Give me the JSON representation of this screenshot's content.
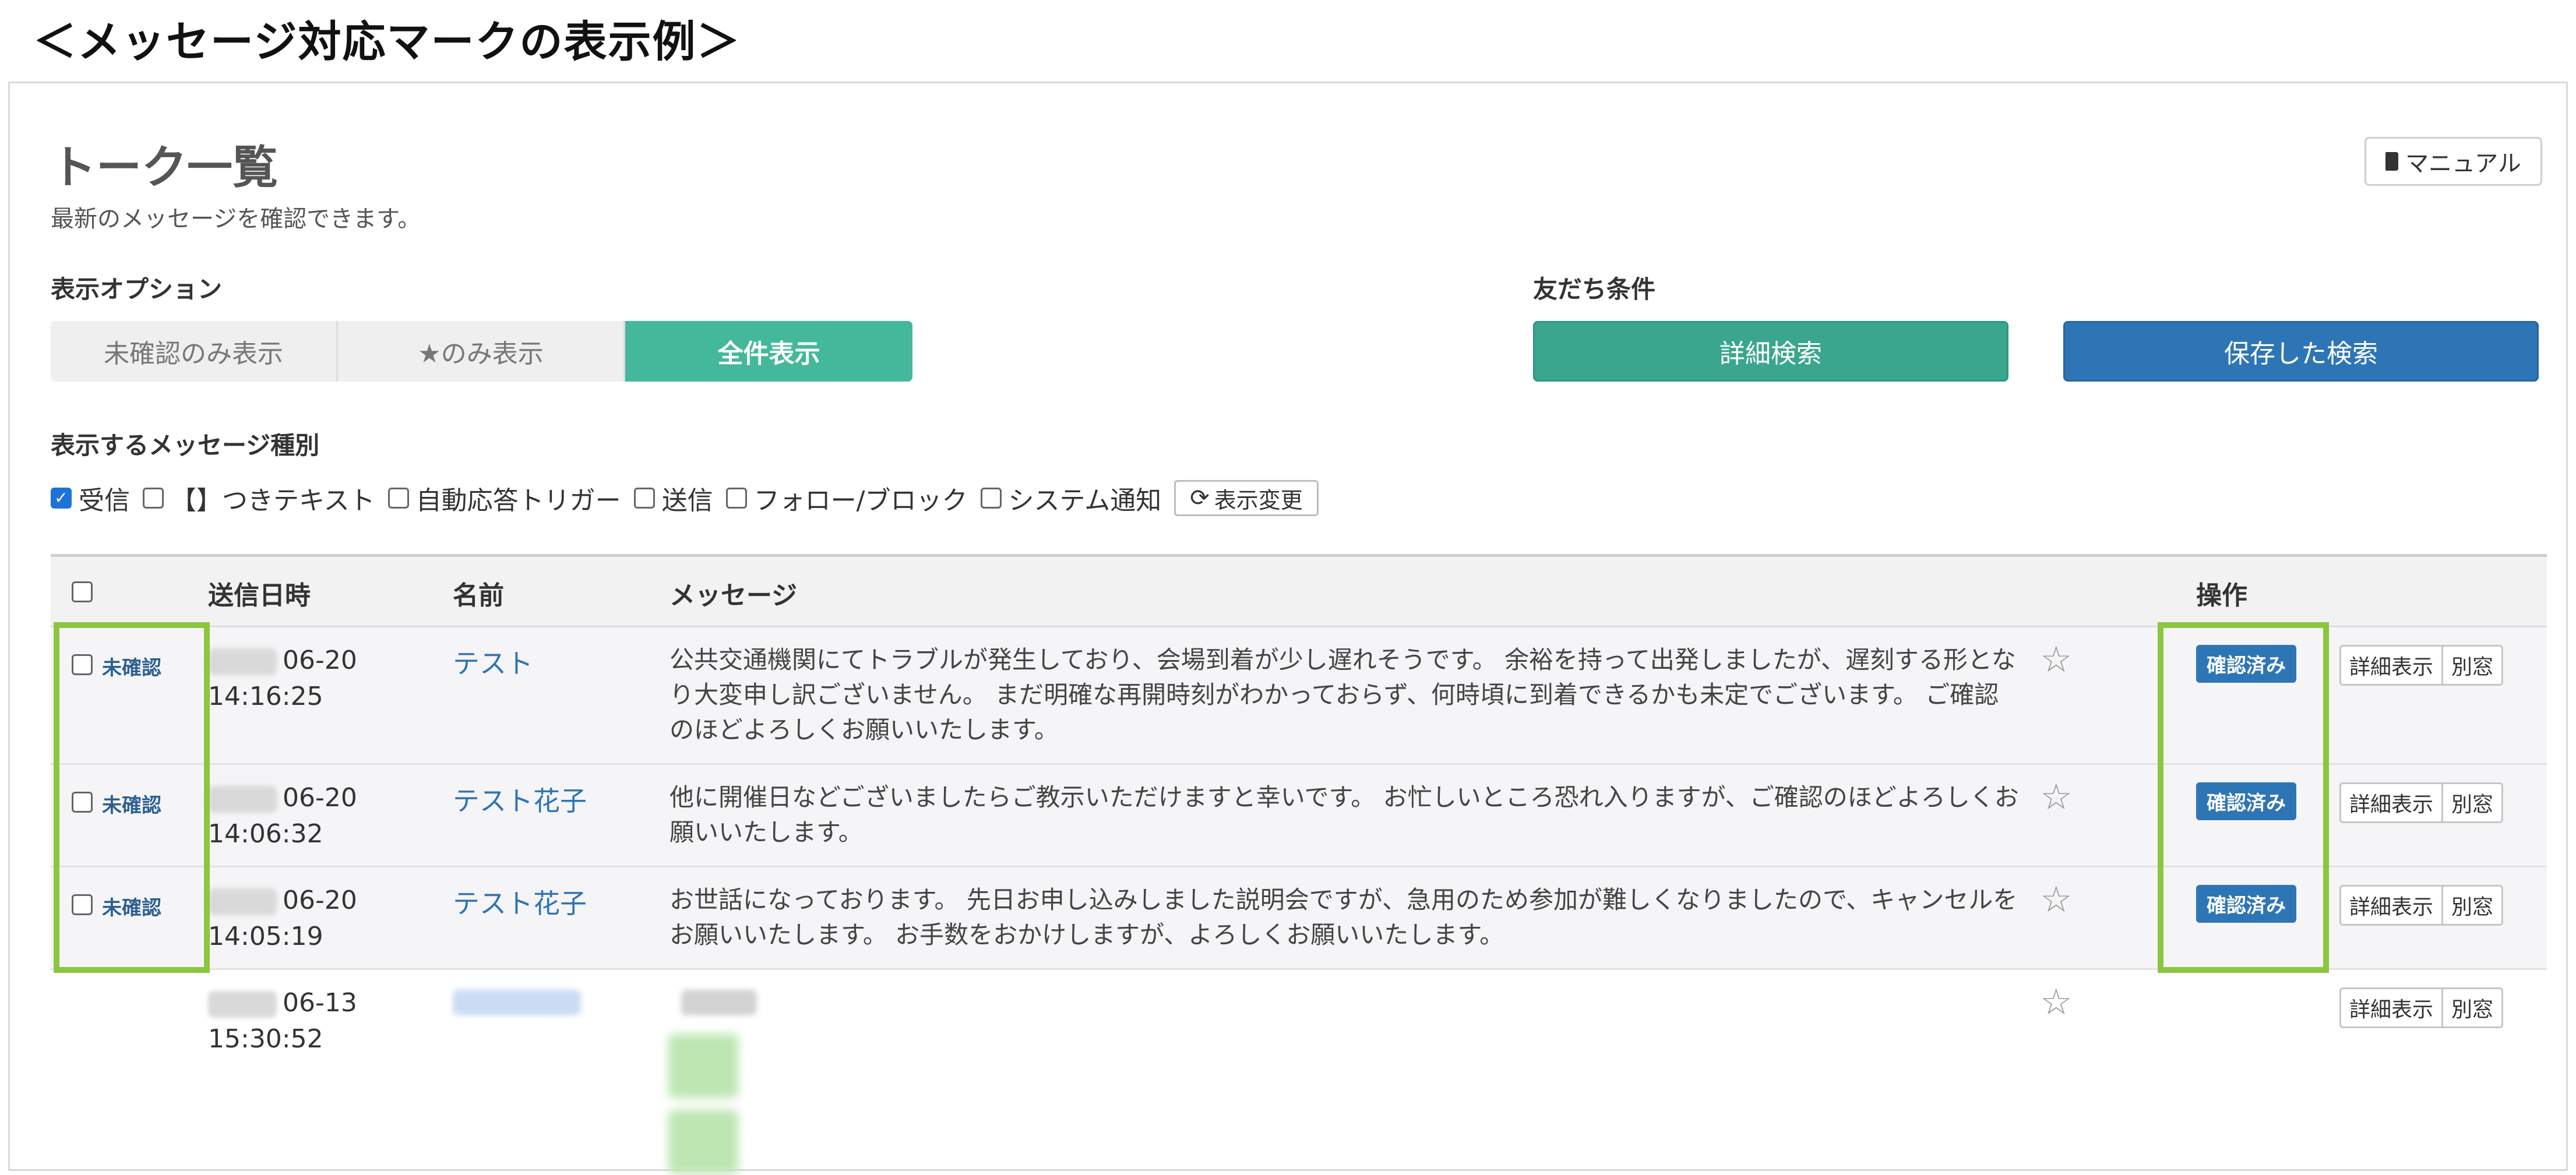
{
  "caption": "＜メッセージ対応マークの表示例＞",
  "header": {
    "title": "トーク一覧",
    "subtitle": "最新のメッセージを確認できます。",
    "manual_button": "マニュアル"
  },
  "display_options": {
    "label": "表示オプション",
    "buttons": [
      "未確認のみ表示",
      "★のみ表示",
      "全件表示"
    ],
    "active": "全件表示"
  },
  "friend_conditions": {
    "label": "友だち条件",
    "detail_search": "詳細検索",
    "saved_search": "保存した検索"
  },
  "message_types": {
    "label": "表示するメッセージ種別",
    "items": [
      {
        "label": "受信",
        "checked": true
      },
      {
        "label": "【】つきテキスト",
        "checked": false
      },
      {
        "label": "自動応答トリガー",
        "checked": false
      },
      {
        "label": "送信",
        "checked": false
      },
      {
        "label": "フォロー/ブロック",
        "checked": false
      },
      {
        "label": "システム通知",
        "checked": false
      }
    ],
    "change_button": "表示変更"
  },
  "table": {
    "columns": [
      "送信日時",
      "名前",
      "メッセージ",
      "操作"
    ],
    "rows": [
      {
        "status": "未確認",
        "date": "06-20",
        "time": "14:16:25",
        "name": "テスト",
        "message": "公共交通機関にてトラブルが発生しており、会場到着が少し遅れそうです。 余裕を持って出発しましたが、遅刻する形となり大変申し訳ございません。 まだ明確な再開時刻がわかっておらず、何時頃に到着できるかも未定でございます。 ご確認のほどよろしくお願いいたします。",
        "confirm_button": "確認済み",
        "detail_button": "詳細表示",
        "window_button": "別窓"
      },
      {
        "status": "未確認",
        "date": "06-20",
        "time": "14:06:32",
        "name": "テスト花子",
        "message": "他に開催日などございましたらご教示いただけますと幸いです。 お忙しいところ恐れ入りますが、ご確認のほどよろしくお願いいたします。",
        "confirm_button": "確認済み",
        "detail_button": "詳細表示",
        "window_button": "別窓"
      },
      {
        "status": "未確認",
        "date": "06-20",
        "time": "14:05:19",
        "name": "テスト花子",
        "message": "お世話になっております。 先日お申し込みしました説明会ですが、急用のため参加が難しくなりましたので、キャンセルをお願いいたします。 お手数をおかけしますが、よろしくお願いいたします。",
        "confirm_button": "確認済み",
        "detail_button": "詳細表示",
        "window_button": "別窓"
      },
      {
        "date": "06-13",
        "time": "15:30:52",
        "detail_button": "詳細表示",
        "window_button": "別窓"
      }
    ]
  },
  "colors": {
    "active_green": "#44b89a",
    "search_green": "#3aa68e",
    "saved_blue": "#2e75b6",
    "highlight": "#8cc63f",
    "link_blue": "#2f74b5"
  }
}
